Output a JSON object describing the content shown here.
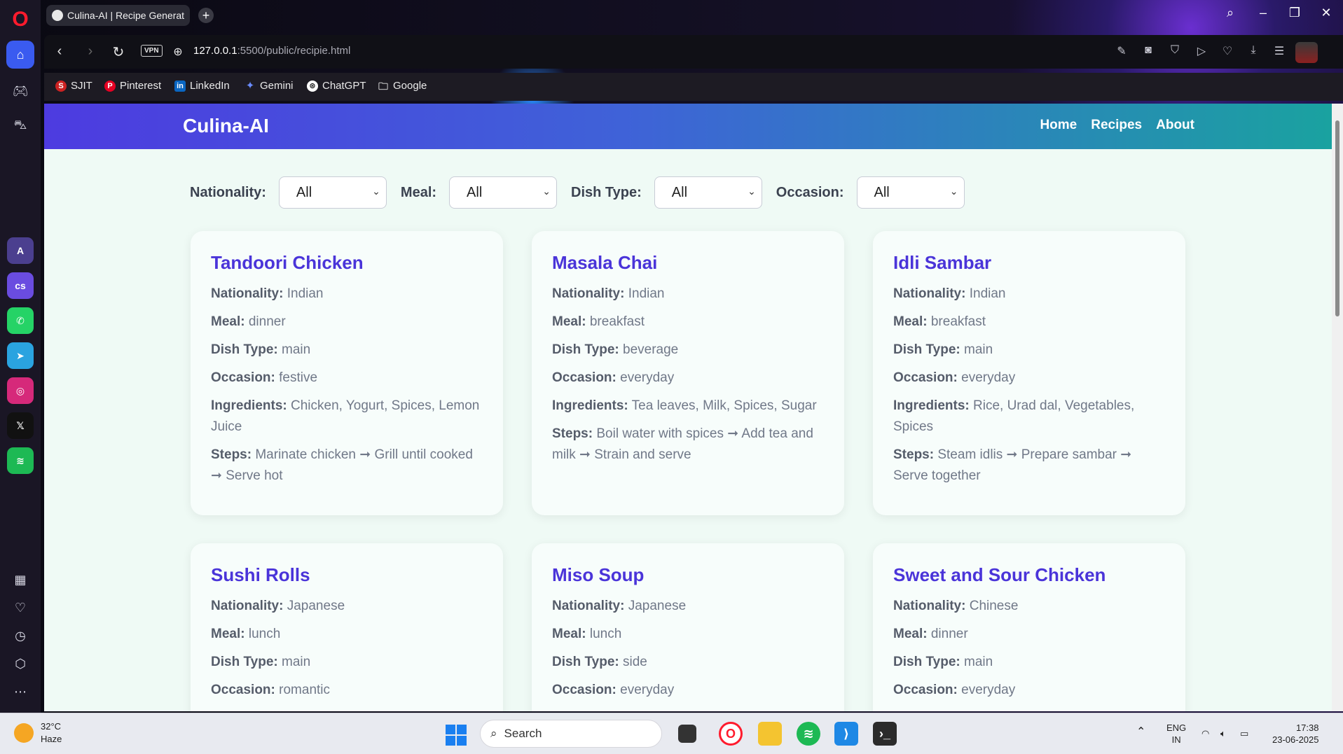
{
  "browser": {
    "tab_title": "Culina-AI | Recipe Generat",
    "new_tab": "+",
    "url_host": "127.0.0.1",
    "url_rest": ":5500/public/recipie.html",
    "vpn": "VPN"
  },
  "bookmarks": [
    {
      "label": "SJIT",
      "icon": "sjit-icon"
    },
    {
      "label": "Pinterest",
      "icon": "pinterest-icon"
    },
    {
      "label": "LinkedIn",
      "icon": "linkedin-icon"
    },
    {
      "label": "Gemini",
      "icon": "gemini-icon"
    },
    {
      "label": "ChatGPT",
      "icon": "chatgpt-icon"
    },
    {
      "label": "Google",
      "icon": "folder-icon"
    }
  ],
  "site": {
    "brand": "Culina-AI",
    "nav": [
      "Home",
      "Recipes",
      "About"
    ]
  },
  "filters": [
    {
      "label": "Nationality:",
      "value": "All"
    },
    {
      "label": "Meal:",
      "value": "All"
    },
    {
      "label": "Dish Type:",
      "value": "All"
    },
    {
      "label": "Occasion:",
      "value": "All"
    }
  ],
  "field_labels": {
    "nationality": "Nationality:",
    "meal": "Meal:",
    "dish_type": "Dish Type:",
    "occasion": "Occasion:",
    "ingredients": "Ingredients:",
    "steps": "Steps:"
  },
  "recipes": [
    {
      "title": "Tandoori Chicken",
      "nationality": "Indian",
      "meal": "dinner",
      "dish_type": "main",
      "occasion": "festive",
      "ingredients": "Chicken, Yogurt, Spices, Lemon Juice",
      "steps": "Marinate chicken ➞ Grill until cooked ➞ Serve hot"
    },
    {
      "title": "Masala Chai",
      "nationality": "Indian",
      "meal": "breakfast",
      "dish_type": "beverage",
      "occasion": "everyday",
      "ingredients": "Tea leaves, Milk, Spices, Sugar",
      "steps": "Boil water with spices ➞ Add tea and milk ➞ Strain and serve"
    },
    {
      "title": "Idli Sambar",
      "nationality": "Indian",
      "meal": "breakfast",
      "dish_type": "main",
      "occasion": "everyday",
      "ingredients": "Rice, Urad dal, Vegetables, Spices",
      "steps": "Steam idlis ➞ Prepare sambar ➞ Serve together"
    },
    {
      "title": "Sushi Rolls",
      "nationality": "Japanese",
      "meal": "lunch",
      "dish_type": "main",
      "occasion": "romantic"
    },
    {
      "title": "Miso Soup",
      "nationality": "Japanese",
      "meal": "lunch",
      "dish_type": "side",
      "occasion": "everyday"
    },
    {
      "title": "Sweet and Sour Chicken",
      "nationality": "Chinese",
      "meal": "dinner",
      "dish_type": "main",
      "occasion": "everyday"
    }
  ],
  "taskbar": {
    "temp": "32°C",
    "weather": "Haze",
    "search": "Search",
    "lang1": "ENG",
    "lang2": "IN",
    "time": "17:38",
    "date": "23-06-2025"
  },
  "colors": {
    "accent": "#4a34d9",
    "header_start": "#4d3be0",
    "header_end": "#1aa2a0",
    "page_bg": "#effaf5"
  }
}
